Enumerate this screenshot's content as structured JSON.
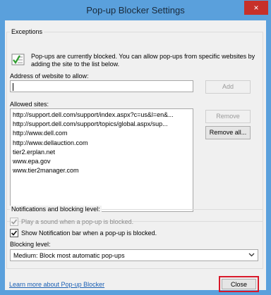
{
  "window": {
    "title": "Pop-up Blocker Settings",
    "close_glyph": "×"
  },
  "exceptions": {
    "legend": "Exceptions",
    "info_text": "Pop-ups are currently blocked.  You can allow pop-ups from specific websites by adding the site to the list below.",
    "address_label": "Address of website to allow:",
    "address_value": "",
    "add_label": "Add",
    "allowed_label": "Allowed sites:",
    "sites": [
      "http://support.dell.com/support/index.aspx?c=us&l=en&...",
      "http://support.dell.com/support/topics/global.aspx/sup...",
      "http://www.dell.com",
      "http://www.dellauction.com",
      "tier2.erplan.net",
      "www.epa.gov",
      "www.tier2manager.com"
    ],
    "remove_label": "Remove",
    "remove_all_label": "Remove all..."
  },
  "notifications": {
    "legend": "Notifications and blocking level:",
    "play_sound_label": "Play a sound when a pop-up is blocked.",
    "play_sound_checked": true,
    "play_sound_enabled": false,
    "show_bar_label": "Show Notification bar when a pop-up is blocked.",
    "show_bar_checked": true,
    "blocking_level_label": "Blocking level:",
    "blocking_level_value": "Medium: Block most automatic pop-ups"
  },
  "footer": {
    "learn_more_label": "Learn more about Pop-up Blocker",
    "close_label": "Close"
  },
  "icons": {
    "info": "checklist-icon",
    "dropdown": "chevron-down-icon",
    "check": "checkmark-icon"
  }
}
